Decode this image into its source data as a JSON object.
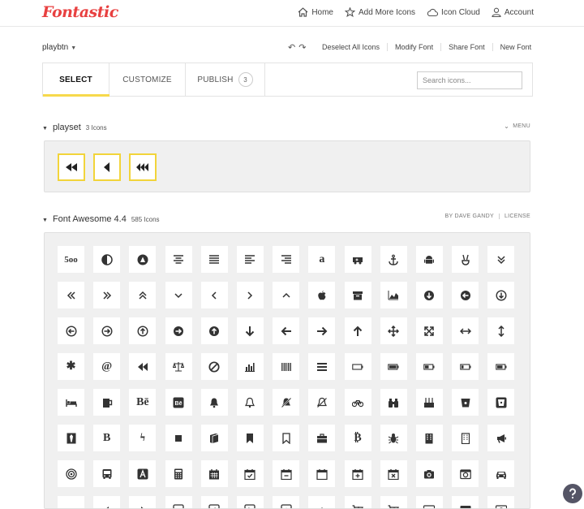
{
  "header": {
    "logo": "Fontastic",
    "nav": [
      {
        "label": "Home",
        "icon": "home-icon"
      },
      {
        "label": "Add More Icons",
        "icon": "star-icon"
      },
      {
        "label": "Icon Cloud",
        "icon": "cloud-icon"
      },
      {
        "label": "Account",
        "icon": "user-icon"
      }
    ]
  },
  "toolbar": {
    "font_name": "playbtn",
    "undo_glyph": "↶",
    "redo_glyph": "↷",
    "actions": [
      "Deselect All Icons",
      "Modify Font",
      "Share Font",
      "New Font"
    ]
  },
  "tabs": {
    "select": "SELECT",
    "customize": "CUSTOMIZE",
    "publish": "PUBLISH",
    "publish_count": "3",
    "search_placeholder": "Search icons..."
  },
  "playset": {
    "name": "playset",
    "count": "3 Icons",
    "menu_label": "MENU",
    "icons": [
      "fast-backward-icon",
      "backward-icon",
      "rewind-icon"
    ]
  },
  "fontawesome": {
    "name": "Font Awesome 4.4",
    "count": "585 Icons",
    "author": "BY DAVE GANDY",
    "license": "LICENSE",
    "rows": [
      [
        "500px-icon",
        "adjust-icon",
        "adn-icon",
        "align-center-icon",
        "align-justify-icon",
        "align-left-icon",
        "align-right-icon",
        "amazon-icon",
        "ambulance-icon",
        "anchor-icon",
        "android-icon",
        "angellist-icon",
        "angle-double-down-icon"
      ],
      [
        "angle-double-left-icon",
        "angle-double-right-icon",
        "angle-double-up-icon",
        "angle-down-icon",
        "angle-left-icon",
        "angle-right-icon",
        "angle-up-icon",
        "apple-icon",
        "archive-icon",
        "area-chart-icon",
        "arrow-circle-down-icon",
        "arrow-circle-left-icon",
        "arrow-circle-o-down-icon"
      ],
      [
        "arrow-circle-o-left-icon",
        "arrow-circle-o-right-icon",
        "arrow-circle-o-up-icon",
        "arrow-circle-right-icon",
        "arrow-circle-up-icon",
        "arrow-down-icon",
        "arrow-left-icon",
        "arrow-right-icon",
        "arrow-up-icon",
        "arrows-icon",
        "arrows-alt-icon",
        "arrows-h-icon",
        "arrows-v-icon"
      ],
      [
        "asterisk-icon",
        "at-icon",
        "backward-icon",
        "balance-scale-icon",
        "ban-icon",
        "bar-chart-icon",
        "barcode-icon",
        "bars-icon",
        "battery-empty-icon",
        "battery-full-icon",
        "battery-half-icon",
        "battery-quarter-icon",
        "battery-three-quarters-icon"
      ],
      [
        "bed-icon",
        "beer-icon",
        "behance-icon",
        "behance-square-icon",
        "bell-icon",
        "bell-o-icon",
        "bell-slash-icon",
        "bell-slash-o-icon",
        "bicycle-icon",
        "binoculars-icon",
        "birthday-cake-icon",
        "bitbucket-icon",
        "bitbucket-square-icon"
      ],
      [
        "black-tie-icon",
        "bold-icon",
        "bolt-icon",
        "bomb-icon",
        "book-icon",
        "bookmark-icon",
        "bookmark-o-icon",
        "briefcase-icon",
        "btc-icon",
        "bug-icon",
        "building-icon",
        "building-o-icon",
        "bullhorn-icon"
      ],
      [
        "bullseye-icon",
        "bus-icon",
        "buysellads-icon",
        "calculator-icon",
        "calendar-icon",
        "calendar-check-o-icon",
        "calendar-minus-o-icon",
        "calendar-o-icon",
        "calendar-plus-o-icon",
        "calendar-times-o-icon",
        "camera-icon",
        "camera-retro-icon",
        "car-icon"
      ],
      [
        "caret-down-icon",
        "caret-left-icon",
        "caret-right-icon",
        "caret-square-o-down-icon",
        "caret-square-o-left-icon",
        "caret-square-o-right-icon",
        "caret-square-o-up-icon",
        "caret-up-icon",
        "cart-arrow-down-icon",
        "cart-plus-icon",
        "cc-icon",
        "cc-amex-icon",
        "cc-diners-club-icon"
      ]
    ],
    "text_glyphs": {
      "500px-icon": "5oo",
      "amazon-icon": "a",
      "at-icon": "@",
      "asterisk-icon": "✱",
      "behance-icon": "Bē",
      "behance-square-icon": "Bē",
      "bold-icon": "B",
      "btc-icon": "₿",
      "bolt-icon": "ϟ",
      "buysellads-icon": "A"
    }
  },
  "help": {
    "icon": "question-icon"
  },
  "colors": {
    "accent_yellow": "#f2d43a",
    "logo_red": "#e84040"
  }
}
